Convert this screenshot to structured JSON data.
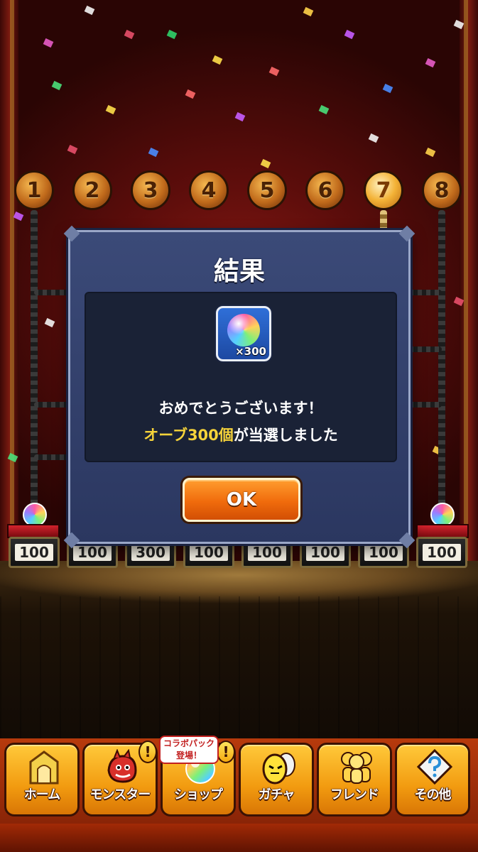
{
  "slots": [
    {
      "number": "1",
      "prize": "100"
    },
    {
      "number": "2",
      "prize": "100"
    },
    {
      "number": "3",
      "prize": "300"
    },
    {
      "number": "4",
      "prize": "100"
    },
    {
      "number": "5",
      "prize": "100"
    },
    {
      "number": "6",
      "prize": "100"
    },
    {
      "number": "7",
      "prize": "100"
    },
    {
      "number": "8",
      "prize": "100"
    }
  ],
  "dialog": {
    "title": "結果",
    "reward_quantity": "×300",
    "message_line1": "おめでとうございます！",
    "message_highlight": "オーブ300個",
    "message_suffix": "が当選しました",
    "ok_label": "OK"
  },
  "nav": {
    "home": "ホーム",
    "monster": "モンスター",
    "shop": "ショップ",
    "gacha": "ガチャ",
    "friend": "フレンド",
    "other": "その他",
    "alert_mark": "!",
    "collab_badge_line1": "コラボパック",
    "collab_badge_line2": "登場！"
  },
  "colors": {
    "highlight_text": "#f6d33a",
    "ok_button": "#f06b0c",
    "dialog_bg": "#3b4a78",
    "nav_button": "#f29b10"
  },
  "icons": {
    "reward": "rainbow-orb-icon",
    "home": "home-gate-icon",
    "monster": "red-dragon-icon",
    "shop": "rainbow-orb-icon",
    "gacha": "yellow-egg-icon",
    "friend": "friends-icon",
    "other": "question-diamond-icon"
  }
}
